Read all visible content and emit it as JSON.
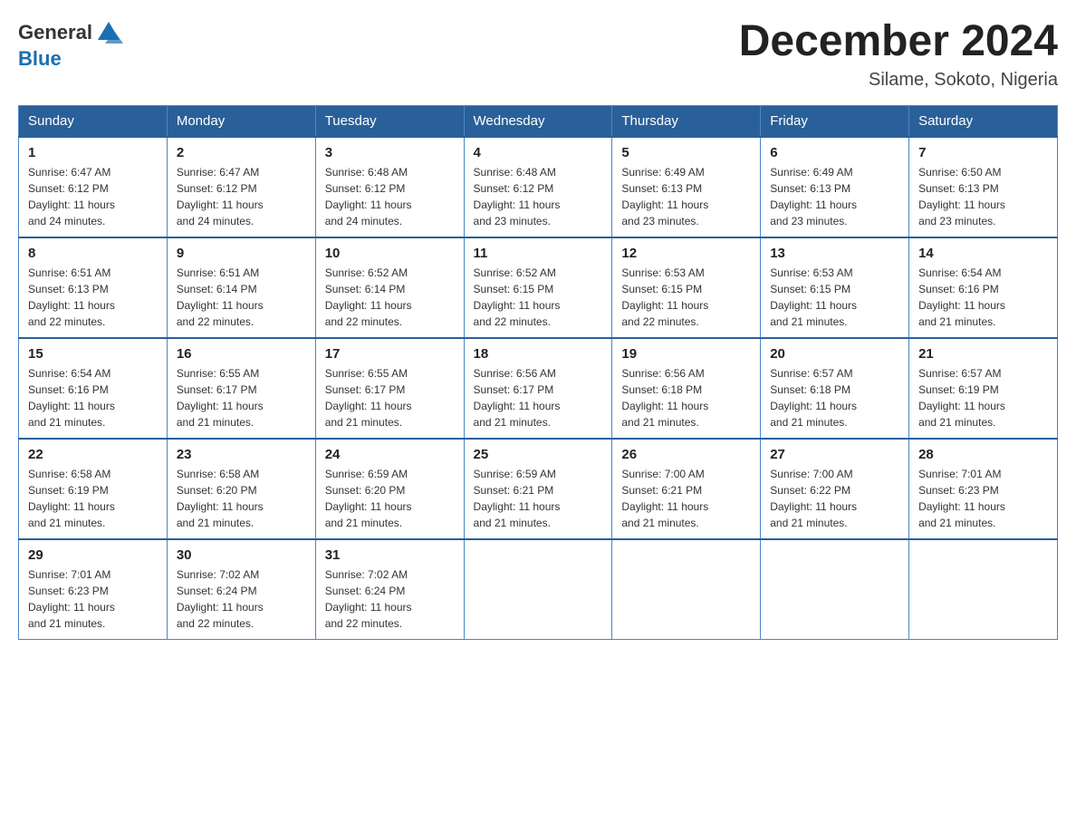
{
  "header": {
    "logo": {
      "text_general": "General",
      "text_blue": "Blue",
      "icon_alt": "GeneralBlue logo"
    },
    "title": "December 2024",
    "location": "Silame, Sokoto, Nigeria"
  },
  "calendar": {
    "days_of_week": [
      "Sunday",
      "Monday",
      "Tuesday",
      "Wednesday",
      "Thursday",
      "Friday",
      "Saturday"
    ],
    "weeks": [
      [
        {
          "day": "1",
          "sunrise": "6:47 AM",
          "sunset": "6:12 PM",
          "daylight": "11 hours and 24 minutes."
        },
        {
          "day": "2",
          "sunrise": "6:47 AM",
          "sunset": "6:12 PM",
          "daylight": "11 hours and 24 minutes."
        },
        {
          "day": "3",
          "sunrise": "6:48 AM",
          "sunset": "6:12 PM",
          "daylight": "11 hours and 24 minutes."
        },
        {
          "day": "4",
          "sunrise": "6:48 AM",
          "sunset": "6:12 PM",
          "daylight": "11 hours and 23 minutes."
        },
        {
          "day": "5",
          "sunrise": "6:49 AM",
          "sunset": "6:13 PM",
          "daylight": "11 hours and 23 minutes."
        },
        {
          "day": "6",
          "sunrise": "6:49 AM",
          "sunset": "6:13 PM",
          "daylight": "11 hours and 23 minutes."
        },
        {
          "day": "7",
          "sunrise": "6:50 AM",
          "sunset": "6:13 PM",
          "daylight": "11 hours and 23 minutes."
        }
      ],
      [
        {
          "day": "8",
          "sunrise": "6:51 AM",
          "sunset": "6:13 PM",
          "daylight": "11 hours and 22 minutes."
        },
        {
          "day": "9",
          "sunrise": "6:51 AM",
          "sunset": "6:14 PM",
          "daylight": "11 hours and 22 minutes."
        },
        {
          "day": "10",
          "sunrise": "6:52 AM",
          "sunset": "6:14 PM",
          "daylight": "11 hours and 22 minutes."
        },
        {
          "day": "11",
          "sunrise": "6:52 AM",
          "sunset": "6:15 PM",
          "daylight": "11 hours and 22 minutes."
        },
        {
          "day": "12",
          "sunrise": "6:53 AM",
          "sunset": "6:15 PM",
          "daylight": "11 hours and 22 minutes."
        },
        {
          "day": "13",
          "sunrise": "6:53 AM",
          "sunset": "6:15 PM",
          "daylight": "11 hours and 21 minutes."
        },
        {
          "day": "14",
          "sunrise": "6:54 AM",
          "sunset": "6:16 PM",
          "daylight": "11 hours and 21 minutes."
        }
      ],
      [
        {
          "day": "15",
          "sunrise": "6:54 AM",
          "sunset": "6:16 PM",
          "daylight": "11 hours and 21 minutes."
        },
        {
          "day": "16",
          "sunrise": "6:55 AM",
          "sunset": "6:17 PM",
          "daylight": "11 hours and 21 minutes."
        },
        {
          "day": "17",
          "sunrise": "6:55 AM",
          "sunset": "6:17 PM",
          "daylight": "11 hours and 21 minutes."
        },
        {
          "day": "18",
          "sunrise": "6:56 AM",
          "sunset": "6:17 PM",
          "daylight": "11 hours and 21 minutes."
        },
        {
          "day": "19",
          "sunrise": "6:56 AM",
          "sunset": "6:18 PM",
          "daylight": "11 hours and 21 minutes."
        },
        {
          "day": "20",
          "sunrise": "6:57 AM",
          "sunset": "6:18 PM",
          "daylight": "11 hours and 21 minutes."
        },
        {
          "day": "21",
          "sunrise": "6:57 AM",
          "sunset": "6:19 PM",
          "daylight": "11 hours and 21 minutes."
        }
      ],
      [
        {
          "day": "22",
          "sunrise": "6:58 AM",
          "sunset": "6:19 PM",
          "daylight": "11 hours and 21 minutes."
        },
        {
          "day": "23",
          "sunrise": "6:58 AM",
          "sunset": "6:20 PM",
          "daylight": "11 hours and 21 minutes."
        },
        {
          "day": "24",
          "sunrise": "6:59 AM",
          "sunset": "6:20 PM",
          "daylight": "11 hours and 21 minutes."
        },
        {
          "day": "25",
          "sunrise": "6:59 AM",
          "sunset": "6:21 PM",
          "daylight": "11 hours and 21 minutes."
        },
        {
          "day": "26",
          "sunrise": "7:00 AM",
          "sunset": "6:21 PM",
          "daylight": "11 hours and 21 minutes."
        },
        {
          "day": "27",
          "sunrise": "7:00 AM",
          "sunset": "6:22 PM",
          "daylight": "11 hours and 21 minutes."
        },
        {
          "day": "28",
          "sunrise": "7:01 AM",
          "sunset": "6:23 PM",
          "daylight": "11 hours and 21 minutes."
        }
      ],
      [
        {
          "day": "29",
          "sunrise": "7:01 AM",
          "sunset": "6:23 PM",
          "daylight": "11 hours and 21 minutes."
        },
        {
          "day": "30",
          "sunrise": "7:02 AM",
          "sunset": "6:24 PM",
          "daylight": "11 hours and 22 minutes."
        },
        {
          "day": "31",
          "sunrise": "7:02 AM",
          "sunset": "6:24 PM",
          "daylight": "11 hours and 22 minutes."
        },
        null,
        null,
        null,
        null
      ]
    ],
    "labels": {
      "sunrise": "Sunrise:",
      "sunset": "Sunset:",
      "daylight": "Daylight:"
    }
  }
}
